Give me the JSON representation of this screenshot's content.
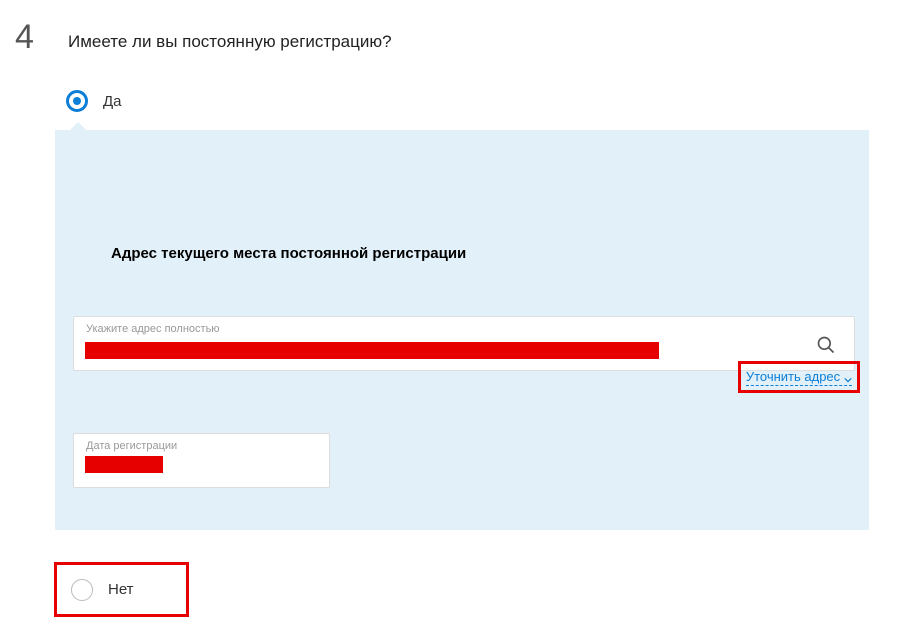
{
  "step": {
    "number": "4",
    "title": "Имеете ли вы постоянную регистрацию?"
  },
  "options": {
    "yes": "Да",
    "no": "Нет"
  },
  "panel": {
    "heading": "Адрес текущего места постоянной регистрации",
    "address_label": "Укажите адрес полностью",
    "refine_link": "Уточнить адрес",
    "date_label": "Дата регистрации"
  }
}
